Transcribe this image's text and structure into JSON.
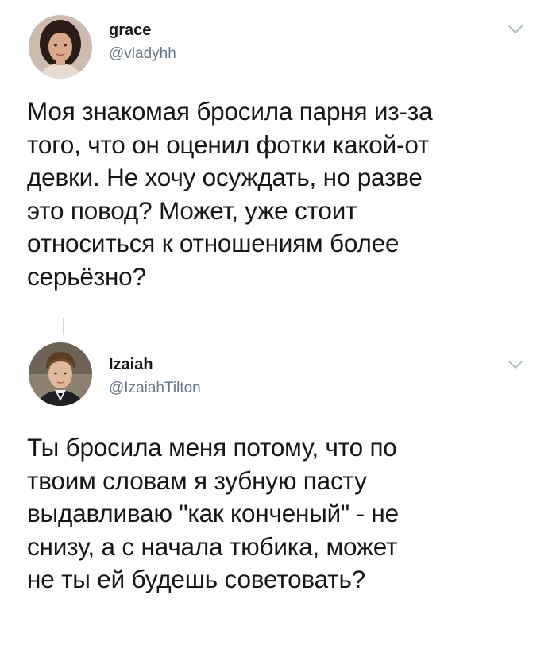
{
  "tweets": [
    {
      "display_name": "grace",
      "handle": "@vladyhh",
      "avatar_icon": "avatar-photo",
      "menu_icon": "chevron-down-icon",
      "text_lines": [
        "Моя знакомая бросила парня из-за",
        "того, что он оценил фотки какой-от",
        "девки. Не хочу осуждать, но разве",
        "это повод? Может, уже стоит",
        "относиться к отношениям более",
        "серьёзно?"
      ]
    },
    {
      "display_name": "Izaiah",
      "handle": "@IzaiahTilton",
      "avatar_icon": "avatar-photo",
      "menu_icon": "chevron-down-icon",
      "text_lines": [
        "Ты бросила меня потому, что по",
        "твоим словам я зубную пасту",
        "выдавливаю \"как конченый\" - не",
        "снизу, а с начала тюбика, может",
        "не ты ей будешь советовать?"
      ]
    }
  ],
  "colors": {
    "text": "#14171a",
    "secondary": "#657786",
    "caret": "#aab8c2",
    "thread_line": "#ccd6dd",
    "background": "#ffffff"
  }
}
